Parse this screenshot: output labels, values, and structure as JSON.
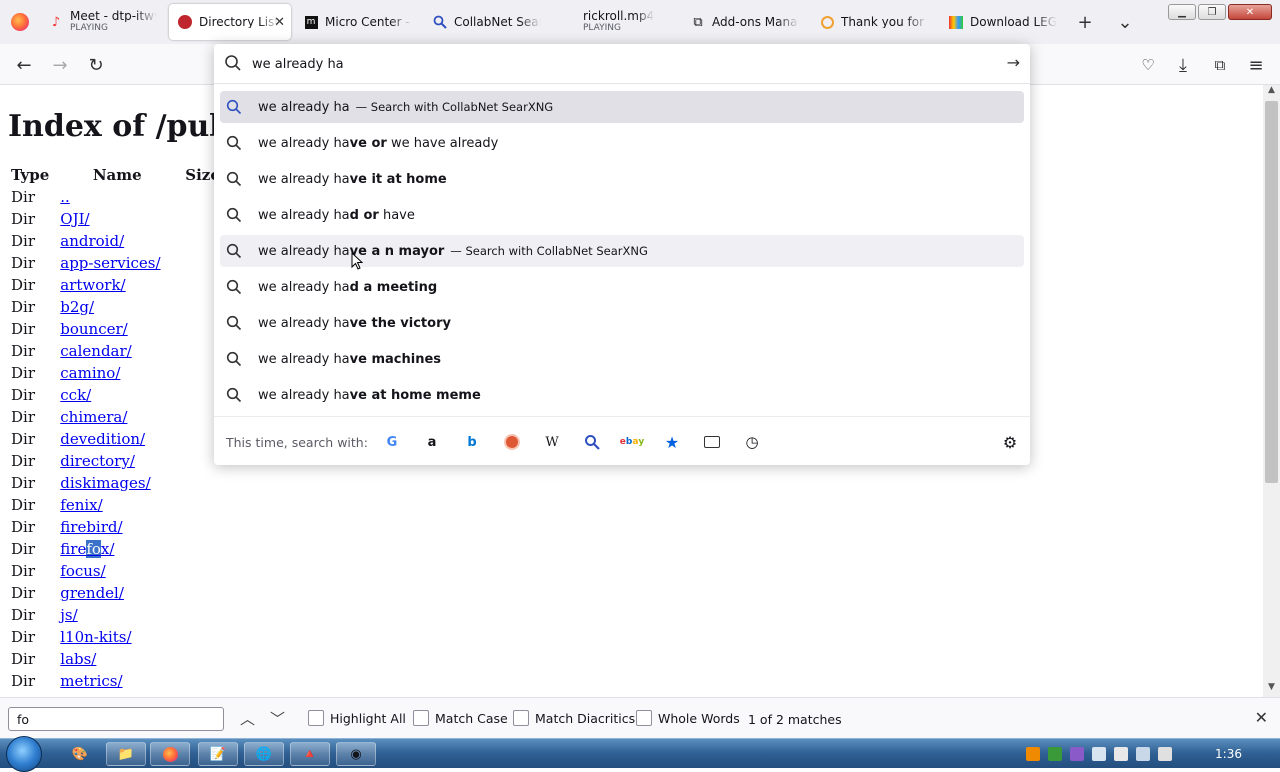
{
  "tabs": [
    {
      "title": "Meet - dtp-itwy",
      "subtitle": "PLAYING",
      "icon": "speaker-icon"
    },
    {
      "title": "Directory List",
      "active": true,
      "icon": "mozilla-icon"
    },
    {
      "title": "Micro Center - I",
      "icon": "microcenter-icon"
    },
    {
      "title": "CollabNet SearX",
      "icon": "search-icon"
    },
    {
      "title": "rickroll.mp4",
      "subtitle": "PLAYING",
      "icon": ""
    },
    {
      "title": "Add-ons Manag",
      "icon": "puzzle-icon"
    },
    {
      "title": "Thank you for i",
      "icon": "circle-icon"
    },
    {
      "title": "Download LEGO",
      "icon": "lego-icon"
    }
  ],
  "urlbar": {
    "query": "we already ha",
    "suggestions": [
      {
        "plain": "we already ha",
        "bold": "",
        "tail": "",
        "action": "— Search with CollabNet SearXNG",
        "selected": true
      },
      {
        "plain": "we already ha",
        "bold": "ve or",
        "tail": " we have already",
        "action": ""
      },
      {
        "plain": "we already ha",
        "bold": "ve it at home",
        "tail": "",
        "action": ""
      },
      {
        "plain": "we already ha",
        "bold": "d or",
        "tail": " have",
        "action": ""
      },
      {
        "plain": "we already ha",
        "bold": "ve a n mayor",
        "tail": "",
        "action": "— Search with CollabNet SearXNG",
        "hover": true
      },
      {
        "plain": "we already ha",
        "bold": "d a meeting",
        "tail": "",
        "action": ""
      },
      {
        "plain": "we already ha",
        "bold": "ve the victory",
        "tail": "",
        "action": ""
      },
      {
        "plain": "we already ha",
        "bold": "ve machines",
        "tail": "",
        "action": ""
      },
      {
        "plain": "we already ha",
        "bold": "ve at home meme",
        "tail": "",
        "action": ""
      }
    ],
    "oneoff_label": "This time, search with:",
    "engines": [
      "google-icon",
      "amazon-icon",
      "bing-icon",
      "duckduckgo-icon",
      "wikipedia-icon",
      "searxng-icon",
      "ebay-icon",
      "bookmarks-icon",
      "tabs-icon",
      "history-icon"
    ]
  },
  "page": {
    "title": "Index of /pub/",
    "headers": [
      "Type",
      "Name",
      "Size"
    ],
    "rows": [
      {
        "type": "Dir",
        "name": ".."
      },
      {
        "type": "Dir",
        "name": "OJI/"
      },
      {
        "type": "Dir",
        "name": "android/"
      },
      {
        "type": "Dir",
        "name": "app-services/"
      },
      {
        "type": "Dir",
        "name": "artwork/"
      },
      {
        "type": "Dir",
        "name": "b2g/"
      },
      {
        "type": "Dir",
        "name": "bouncer/"
      },
      {
        "type": "Dir",
        "name": "calendar/"
      },
      {
        "type": "Dir",
        "name": "camino/"
      },
      {
        "type": "Dir",
        "name": "cck/"
      },
      {
        "type": "Dir",
        "name": "chimera/"
      },
      {
        "type": "Dir",
        "name": "devedition/"
      },
      {
        "type": "Dir",
        "name": "directory/"
      },
      {
        "type": "Dir",
        "name": "diskimages/"
      },
      {
        "type": "Dir",
        "name": "fenix/"
      },
      {
        "type": "Dir",
        "name": "firebird/"
      },
      {
        "type": "Dir",
        "name": "firefox/"
      },
      {
        "type": "Dir",
        "name": "focus/"
      },
      {
        "type": "Dir",
        "name": "grendel/"
      },
      {
        "type": "Dir",
        "name": "js/"
      },
      {
        "type": "Dir",
        "name": "l10n-kits/"
      },
      {
        "type": "Dir",
        "name": "labs/"
      },
      {
        "type": "Dir",
        "name": "metrics/"
      }
    ]
  },
  "findbar": {
    "value": "fo",
    "highlight_all": "Highlight All",
    "match_case": "Match Case",
    "match_diacritics": "Match Diacritics",
    "whole_words": "Whole Words",
    "status": "1 of 2 matches"
  },
  "taskbar": {
    "clock": "1:36"
  }
}
